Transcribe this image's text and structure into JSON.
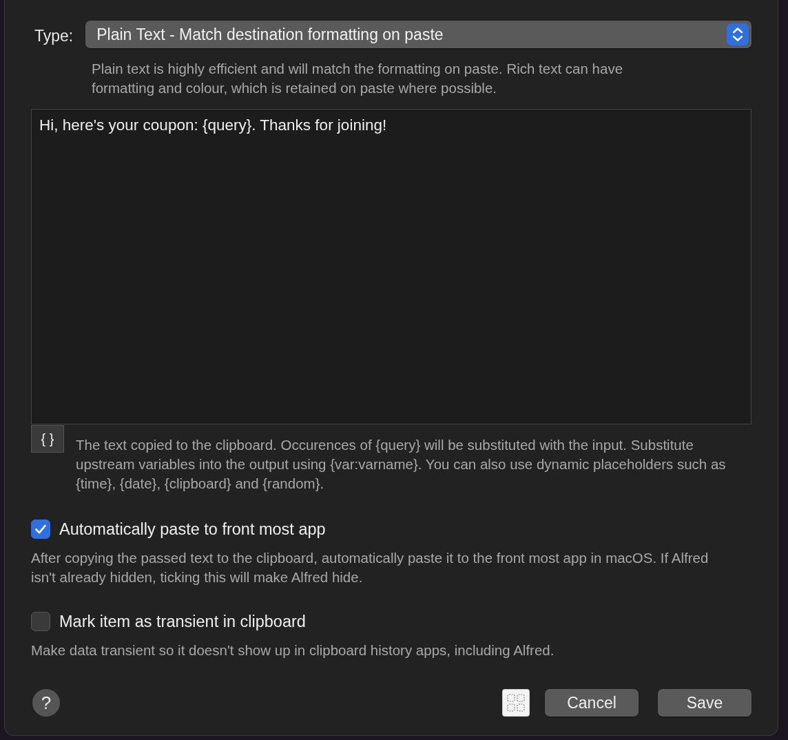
{
  "type_field": {
    "label": "Type:",
    "value": "Plain Text - Match destination formatting on paste",
    "hint": "Plain text is highly efficient and will match the formatting on paste. Rich text can have formatting and colour, which is retained on paste where possible."
  },
  "editor": {
    "value": "Hi, here's your coupon: {query}. Thanks for joining!",
    "placeholder_button": "{ }",
    "description": "The text copied to the clipboard. Occurences of {query} will be substituted with the input. Substitute upstream variables into the output using {var:varname}. You can also use dynamic placeholders such as {time}, {date}, {clipboard} and {random}."
  },
  "options": [
    {
      "label": "Automatically paste to front most app",
      "checked": true,
      "description": "After copying the passed text to the clipboard, automatically paste it to the front most app in macOS. If Alfred isn't already hidden, ticking this will make Alfred hide."
    },
    {
      "label": "Mark item as transient in clipboard",
      "checked": false,
      "description": "Make data transient so it doesn't show up in clipboard history apps, including Alfred."
    }
  ],
  "help_button": "?",
  "buttons": [
    {
      "label": "Cancel"
    },
    {
      "label": "Save"
    }
  ]
}
